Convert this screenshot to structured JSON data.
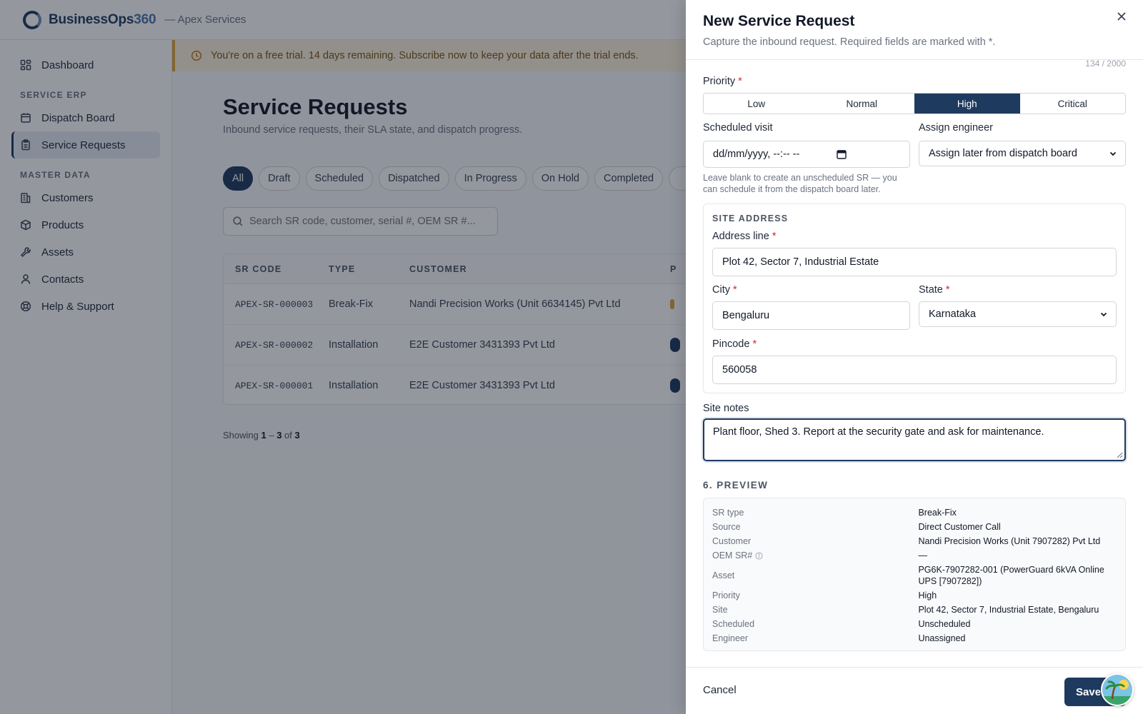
{
  "app": {
    "brand_main": "BusinessOps",
    "brand_accent": "360",
    "org": "— Apex Services"
  },
  "sidebar": {
    "top_items": [
      {
        "label": "Dashboard",
        "icon": "grid-icon"
      }
    ],
    "section_service": "SERVICE ERP",
    "service_items": [
      {
        "label": "Dispatch Board",
        "icon": "calendar-icon"
      },
      {
        "label": "Service Requests",
        "icon": "clipboard-icon",
        "active": true
      }
    ],
    "section_master": "MASTER DATA",
    "master_items": [
      {
        "label": "Customers",
        "icon": "building-icon"
      },
      {
        "label": "Products",
        "icon": "box-icon"
      },
      {
        "label": "Assets",
        "icon": "wrench-icon"
      },
      {
        "label": "Contacts",
        "icon": "user-icon"
      },
      {
        "label": "Help & Support",
        "icon": "lifebuoy-icon"
      }
    ]
  },
  "banner": {
    "text": "You're on a free trial. 14 days remaining. Subscribe now to keep your data after the trial ends."
  },
  "page": {
    "title": "Service Requests",
    "subtitle": "Inbound service requests, their SLA state, and dispatch progress.",
    "filters": [
      "All",
      "Draft",
      "Scheduled",
      "Dispatched",
      "In Progress",
      "On Hold",
      "Completed"
    ],
    "active_filter": "All",
    "search_placeholder": "Search SR code, customer, serial #, OEM SR #...",
    "table": {
      "headers": [
        "SR CODE",
        "TYPE",
        "CUSTOMER",
        "P"
      ],
      "rows": [
        {
          "code": "APEX-SR-000003",
          "type": "Break-Fix",
          "customer": "Nandi Precision Works (Unit 6634145) Pvt Ltd"
        },
        {
          "code": "APEX-SR-000002",
          "type": "Installation",
          "customer": "E2E Customer 3431393 Pvt Ltd"
        },
        {
          "code": "APEX-SR-000001",
          "type": "Installation",
          "customer": "E2E Customer 3431393 Pvt Ltd"
        }
      ]
    },
    "showing": {
      "prefix": "Showing ",
      "from": "1",
      "dash": " – ",
      "to": "3",
      "of": " of ",
      "total": "3"
    }
  },
  "drawer": {
    "title": "New Service Request",
    "subtitle": "Capture the inbound request. Required fields are marked with *.",
    "char_count": "134 / 2000",
    "priority": {
      "label": "Priority",
      "required": "*",
      "options": [
        "Low",
        "Normal",
        "High",
        "Critical"
      ],
      "selected": "High"
    },
    "scheduled_visit": {
      "label": "Scheduled visit",
      "value": "dd/mm/yyyy, --:-- --",
      "hint": "Leave blank to create an unscheduled SR — you can schedule it from the dispatch board later."
    },
    "assign_engineer": {
      "label": "Assign engineer",
      "value": "Assign later from dispatch board"
    },
    "site_address": {
      "heading": "SITE ADDRESS",
      "address_label": "Address line",
      "address_value": "Plot 42, Sector 7, Industrial Estate",
      "city_label": "City",
      "city_value": "Bengaluru",
      "state_label": "State",
      "state_value": "Karnataka",
      "pincode_label": "Pincode",
      "pincode_value": "560058",
      "required": "*"
    },
    "site_notes": {
      "label": "Site notes",
      "value": "Plant floor, Shed 3. Report at the security gate and ask for maintenance."
    },
    "preview": {
      "heading": "6. PREVIEW",
      "rows": [
        {
          "k": "SR type",
          "v": "Break-Fix"
        },
        {
          "k": "Source",
          "v": "Direct Customer Call"
        },
        {
          "k": "Customer",
          "v": "Nandi Precision Works (Unit 7907282) Pvt Ltd"
        },
        {
          "k": "OEM SR#",
          "v": "—"
        },
        {
          "k": "Asset",
          "v": "PG6K-7907282-001 (PowerGuard 6kVA Online UPS [7907282])"
        },
        {
          "k": "Priority",
          "v": "High"
        },
        {
          "k": "Site",
          "v": "Plot 42, Sector 7, Industrial Estate, Bengaluru"
        },
        {
          "k": "Scheduled",
          "v": "Unscheduled"
        },
        {
          "k": "Engineer",
          "v": "Unassigned"
        }
      ]
    },
    "footer": {
      "cancel": "Cancel",
      "save": "Save"
    }
  },
  "colors": {
    "primary": "#1e3a5f",
    "warning_bg": "#fdf3df",
    "warning_border": "#e0a43a",
    "required": "#dc2626"
  }
}
